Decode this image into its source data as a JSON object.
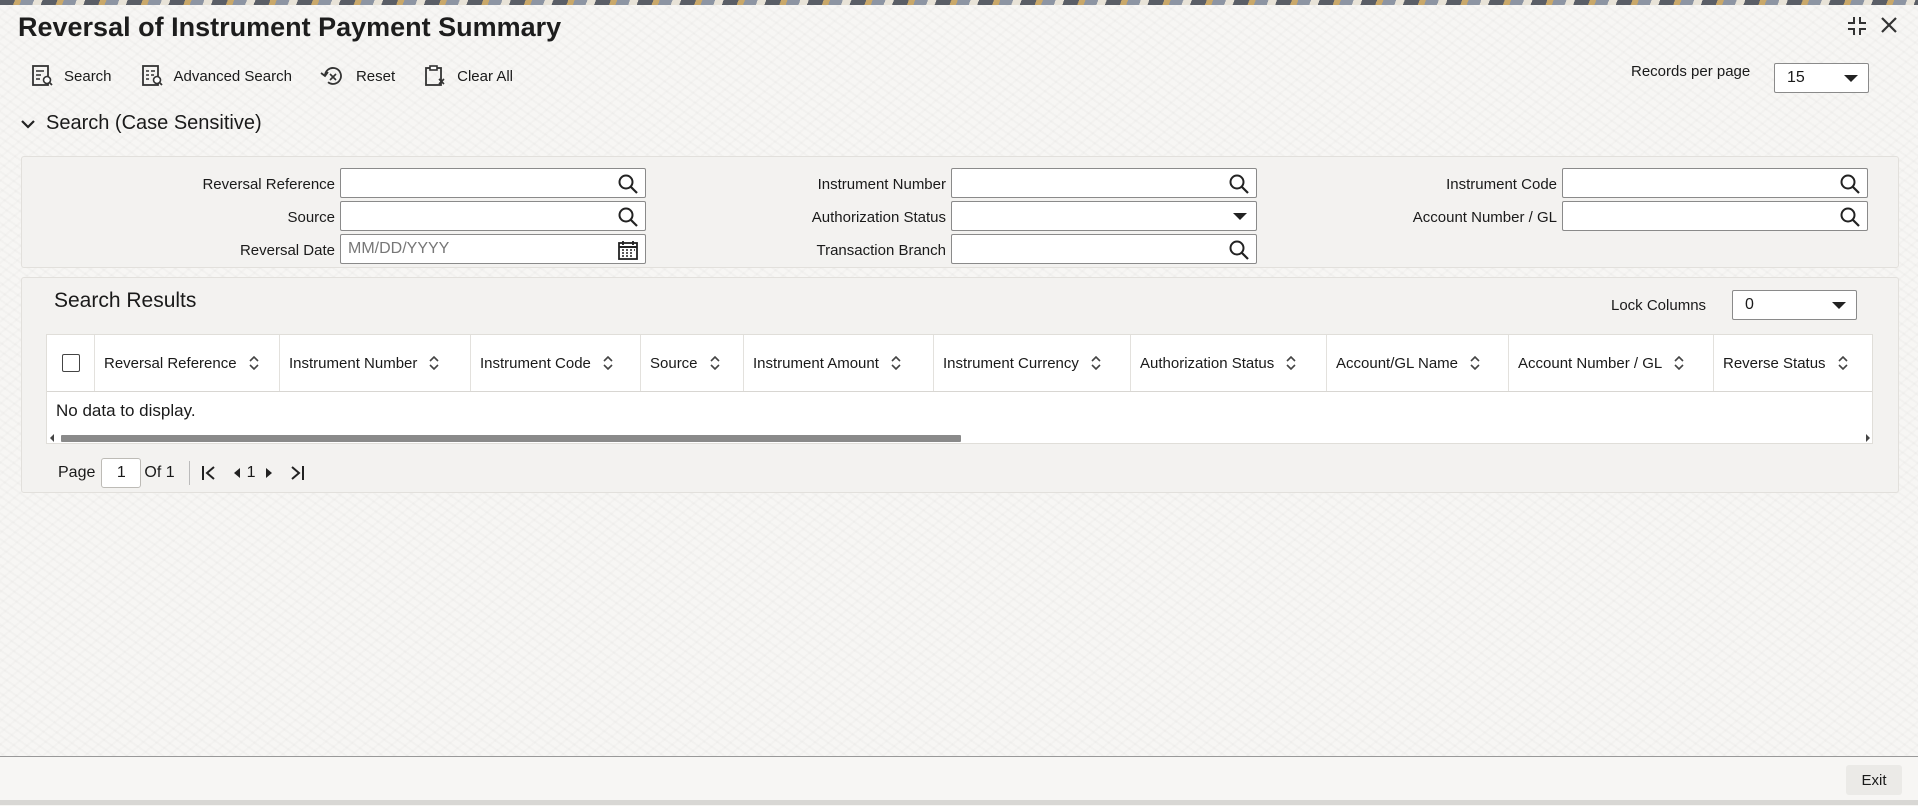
{
  "window": {
    "title": "Reversal of Instrument Payment Summary"
  },
  "toolbar": {
    "search_label": "Search",
    "advanced_search_label": "Advanced Search",
    "reset_label": "Reset",
    "clear_all_label": "Clear All",
    "records_per_page_label": "Records per page",
    "records_per_page_value": "15"
  },
  "search_section": {
    "title": "Search (Case Sensitive)",
    "fields": {
      "reversal_reference": {
        "label": "Reversal Reference",
        "value": ""
      },
      "source": {
        "label": "Source",
        "value": ""
      },
      "reversal_date": {
        "label": "Reversal Date",
        "value": "",
        "placeholder": "MM/DD/YYYY"
      },
      "instrument_number": {
        "label": "Instrument Number",
        "value": ""
      },
      "authorization_status": {
        "label": "Authorization Status",
        "value": ""
      },
      "transaction_branch": {
        "label": "Transaction Branch",
        "value": ""
      },
      "instrument_code": {
        "label": "Instrument Code",
        "value": ""
      },
      "account_number_gl": {
        "label": "Account Number / GL",
        "value": ""
      }
    }
  },
  "results": {
    "title": "Search Results",
    "lock_columns_label": "Lock Columns",
    "lock_columns_value": "0",
    "columns": [
      "Reversal Reference",
      "Instrument Number",
      "Instrument Code",
      "Source",
      "Instrument Amount",
      "Instrument Currency",
      "Authorization Status",
      "Account/GL Name",
      "Account Number / GL",
      "Reverse Status"
    ],
    "empty_message": "No data to display."
  },
  "pagination": {
    "page_label": "Page",
    "current_page": "1",
    "of_label": "Of 1",
    "page_number": "1"
  },
  "footer": {
    "exit_label": "Exit"
  },
  "colors": {
    "accent": "#1d1d1d",
    "border": "#8a8a8a",
    "panel": "#f3f2f0"
  }
}
